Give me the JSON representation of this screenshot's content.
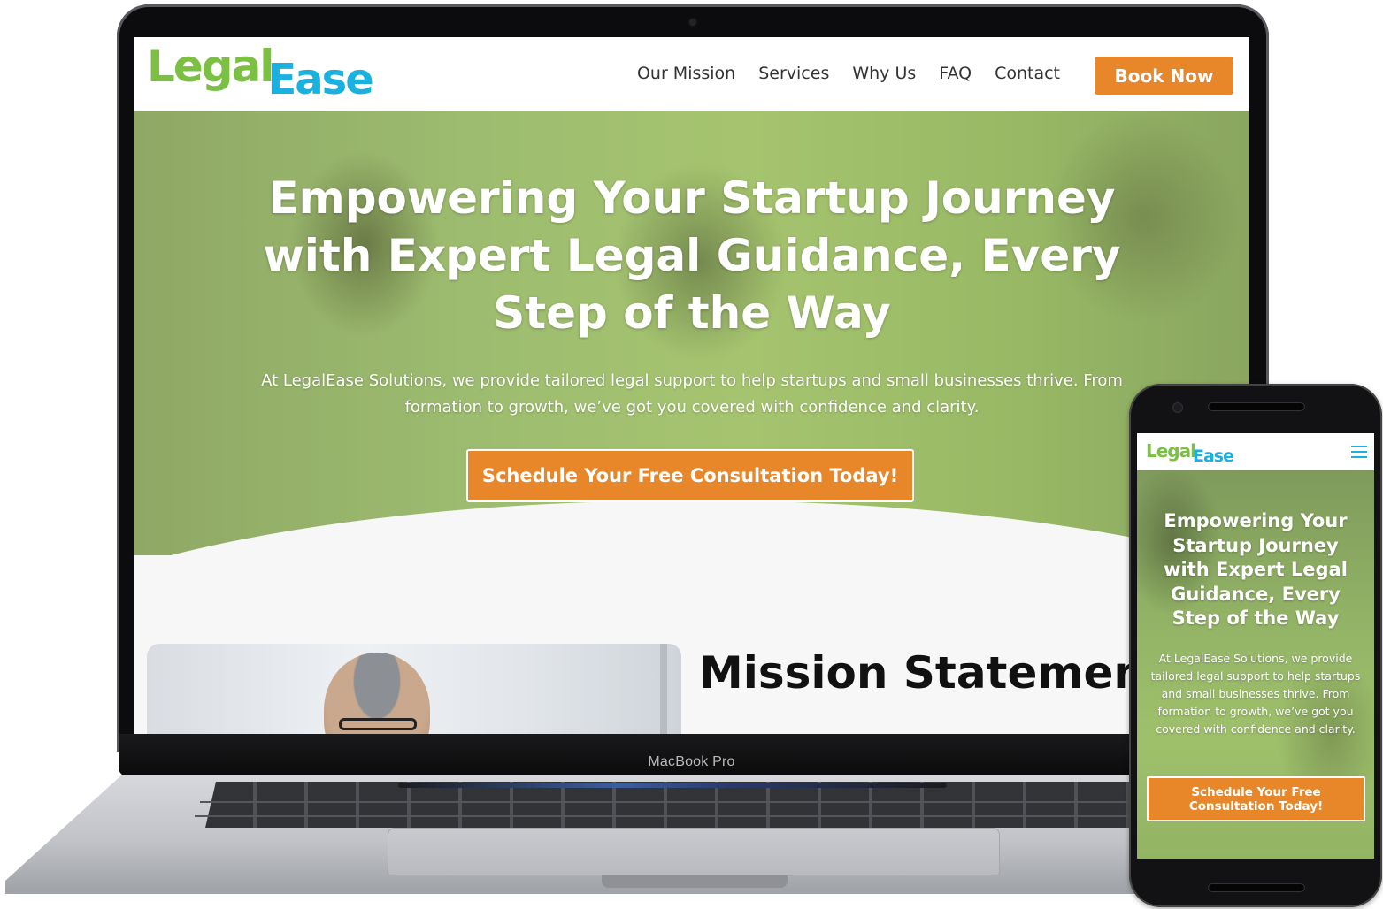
{
  "brand": {
    "logo_part1": "Legal",
    "logo_part2": "Ease",
    "colors": {
      "green": "#7bc043",
      "blue": "#1ab0e0",
      "orange": "#e8872a"
    }
  },
  "laptop": {
    "brand_label": "MacBook Pro",
    "nav": [
      "Our Mission",
      "Services",
      "Why Us",
      "FAQ",
      "Contact"
    ],
    "book_button": "Book Now",
    "hero": {
      "title": "Empowering Your Startup Journey with Expert Legal Guidance, Every Step of the Way",
      "subtitle": "At LegalEase Solutions, we provide tailored legal support to help startups and small businesses thrive. From formation to growth, we’ve got you covered with confidence and clarity.",
      "cta": "Schedule Your Free Consultation Today!"
    },
    "mission": {
      "title": "Mission Statement"
    }
  },
  "phone": {
    "menu_icon": "hamburger-menu-icon",
    "hero": {
      "title": "Empowering Your Startup Journey with Expert Legal Guidance, Every Step of the Way",
      "subtitle": "At LegalEase Solutions, we provide tailored legal support to help startups and small businesses thrive. From formation to growth, we’ve got you covered with confidence and clarity.",
      "cta": "Schedule Your Free Consultation Today!"
    }
  }
}
